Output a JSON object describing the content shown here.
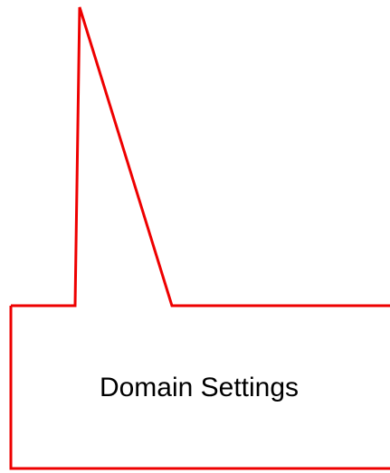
{
  "callout": {
    "label": "Domain Settings",
    "outline_color": "#ee0000",
    "background_color": "#ffffff"
  }
}
